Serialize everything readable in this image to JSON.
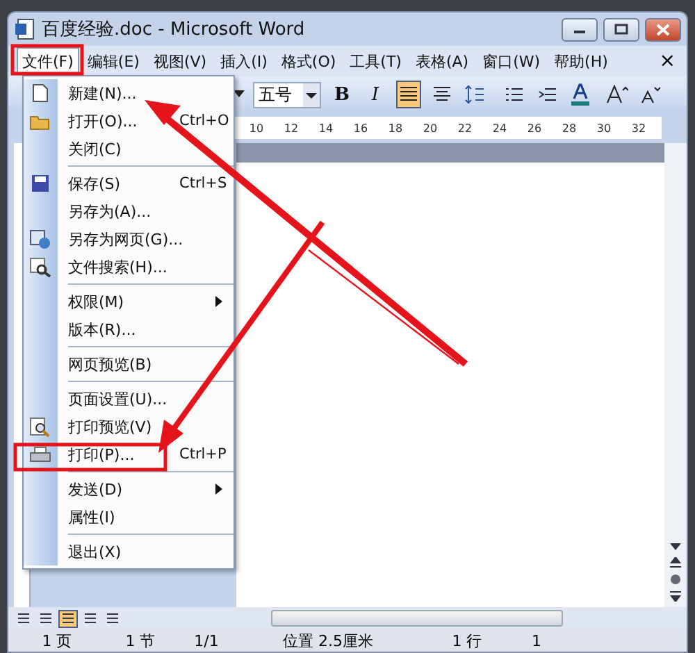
{
  "window": {
    "title": "百度经验.doc - Microsoft Word"
  },
  "menubar": [
    {
      "label": "文件(F)",
      "selected": true
    },
    {
      "label": "编辑(E)",
      "selected": false
    },
    {
      "label": "视图(V)",
      "selected": false
    },
    {
      "label": "插入(I)",
      "selected": false
    },
    {
      "label": "格式(O)",
      "selected": false
    },
    {
      "label": "工具(T)",
      "selected": false
    },
    {
      "label": "表格(A)",
      "selected": false
    },
    {
      "label": "窗口(W)",
      "selected": false
    },
    {
      "label": "帮助(H)",
      "selected": false
    }
  ],
  "close_document": "×",
  "toolbar": {
    "font_size": "五号",
    "bold": "B",
    "italic": "I",
    "align_left_active": true
  },
  "ruler": [
    "10",
    "12",
    "14",
    "16",
    "18",
    "20",
    "22",
    "24",
    "26",
    "28",
    "30",
    "32"
  ],
  "file_menu": [
    {
      "kind": "item",
      "label": "新建(N)..."
    },
    {
      "kind": "item",
      "label": "打开(O)...",
      "shortcut": "Ctrl+O"
    },
    {
      "kind": "item",
      "label": "关闭(C)"
    },
    {
      "kind": "separator"
    },
    {
      "kind": "item",
      "label": "保存(S)",
      "shortcut": "Ctrl+S"
    },
    {
      "kind": "item",
      "label": "另存为(A)..."
    },
    {
      "kind": "item",
      "label": "另存为网页(G)..."
    },
    {
      "kind": "item",
      "label": "文件搜索(H)..."
    },
    {
      "kind": "separator"
    },
    {
      "kind": "submenu",
      "label": "权限(M)"
    },
    {
      "kind": "item",
      "label": "版本(R)..."
    },
    {
      "kind": "separator"
    },
    {
      "kind": "item",
      "label": "网页预览(B)"
    },
    {
      "kind": "separator"
    },
    {
      "kind": "item",
      "label": "页面设置(U)..."
    },
    {
      "kind": "item",
      "label": "打印预览(V)"
    },
    {
      "kind": "item",
      "label": "打印(P)...",
      "shortcut": "Ctrl+P"
    },
    {
      "kind": "separator"
    },
    {
      "kind": "submenu",
      "label": "发送(D)"
    },
    {
      "kind": "item",
      "label": "属性(I)"
    },
    {
      "kind": "separator"
    },
    {
      "kind": "item",
      "label": "退出(X)"
    }
  ],
  "view_buttons": [
    {
      "selected": false
    },
    {
      "selected": false
    },
    {
      "selected": true
    },
    {
      "selected": false
    },
    {
      "selected": false
    }
  ],
  "status_bar": [
    "1 页",
    "1 节",
    "1/1",
    "位置 2.5厘米",
    "1 行",
    "1"
  ]
}
